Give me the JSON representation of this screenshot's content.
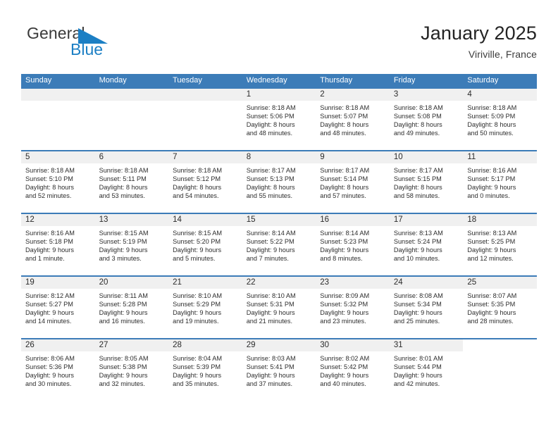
{
  "logo": {
    "word1": "General",
    "word2": "Blue",
    "triangle_color": "#1c7fc4",
    "word1_color": "#3a3a3a",
    "word2_color": "#1c7fc4"
  },
  "header": {
    "title": "January 2025",
    "subtitle": "Viriville, France"
  },
  "theme": {
    "header_bg": "#3c7cb8",
    "header_text": "#ffffff",
    "daynum_bg": "#f0f0f0",
    "row_border": "#3c7cb8",
    "body_text": "#2d2d2d"
  },
  "columns": [
    "Sunday",
    "Monday",
    "Tuesday",
    "Wednesday",
    "Thursday",
    "Friday",
    "Saturday"
  ],
  "weeks": [
    [
      {
        "day": "",
        "empty": true
      },
      {
        "day": "",
        "empty": true
      },
      {
        "day": "",
        "empty": true
      },
      {
        "day": "1",
        "sunrise": "Sunrise: 8:18 AM",
        "sunset": "Sunset: 5:06 PM",
        "daylight1": "Daylight: 8 hours",
        "daylight2": "and 48 minutes."
      },
      {
        "day": "2",
        "sunrise": "Sunrise: 8:18 AM",
        "sunset": "Sunset: 5:07 PM",
        "daylight1": "Daylight: 8 hours",
        "daylight2": "and 48 minutes."
      },
      {
        "day": "3",
        "sunrise": "Sunrise: 8:18 AM",
        "sunset": "Sunset: 5:08 PM",
        "daylight1": "Daylight: 8 hours",
        "daylight2": "and 49 minutes."
      },
      {
        "day": "4",
        "sunrise": "Sunrise: 8:18 AM",
        "sunset": "Sunset: 5:09 PM",
        "daylight1": "Daylight: 8 hours",
        "daylight2": "and 50 minutes."
      }
    ],
    [
      {
        "day": "5",
        "sunrise": "Sunrise: 8:18 AM",
        "sunset": "Sunset: 5:10 PM",
        "daylight1": "Daylight: 8 hours",
        "daylight2": "and 52 minutes."
      },
      {
        "day": "6",
        "sunrise": "Sunrise: 8:18 AM",
        "sunset": "Sunset: 5:11 PM",
        "daylight1": "Daylight: 8 hours",
        "daylight2": "and 53 minutes."
      },
      {
        "day": "7",
        "sunrise": "Sunrise: 8:18 AM",
        "sunset": "Sunset: 5:12 PM",
        "daylight1": "Daylight: 8 hours",
        "daylight2": "and 54 minutes."
      },
      {
        "day": "8",
        "sunrise": "Sunrise: 8:17 AM",
        "sunset": "Sunset: 5:13 PM",
        "daylight1": "Daylight: 8 hours",
        "daylight2": "and 55 minutes."
      },
      {
        "day": "9",
        "sunrise": "Sunrise: 8:17 AM",
        "sunset": "Sunset: 5:14 PM",
        "daylight1": "Daylight: 8 hours",
        "daylight2": "and 57 minutes."
      },
      {
        "day": "10",
        "sunrise": "Sunrise: 8:17 AM",
        "sunset": "Sunset: 5:15 PM",
        "daylight1": "Daylight: 8 hours",
        "daylight2": "and 58 minutes."
      },
      {
        "day": "11",
        "sunrise": "Sunrise: 8:16 AM",
        "sunset": "Sunset: 5:17 PM",
        "daylight1": "Daylight: 9 hours",
        "daylight2": "and 0 minutes."
      }
    ],
    [
      {
        "day": "12",
        "sunrise": "Sunrise: 8:16 AM",
        "sunset": "Sunset: 5:18 PM",
        "daylight1": "Daylight: 9 hours",
        "daylight2": "and 1 minute."
      },
      {
        "day": "13",
        "sunrise": "Sunrise: 8:15 AM",
        "sunset": "Sunset: 5:19 PM",
        "daylight1": "Daylight: 9 hours",
        "daylight2": "and 3 minutes."
      },
      {
        "day": "14",
        "sunrise": "Sunrise: 8:15 AM",
        "sunset": "Sunset: 5:20 PM",
        "daylight1": "Daylight: 9 hours",
        "daylight2": "and 5 minutes."
      },
      {
        "day": "15",
        "sunrise": "Sunrise: 8:14 AM",
        "sunset": "Sunset: 5:22 PM",
        "daylight1": "Daylight: 9 hours",
        "daylight2": "and 7 minutes."
      },
      {
        "day": "16",
        "sunrise": "Sunrise: 8:14 AM",
        "sunset": "Sunset: 5:23 PM",
        "daylight1": "Daylight: 9 hours",
        "daylight2": "and 8 minutes."
      },
      {
        "day": "17",
        "sunrise": "Sunrise: 8:13 AM",
        "sunset": "Sunset: 5:24 PM",
        "daylight1": "Daylight: 9 hours",
        "daylight2": "and 10 minutes."
      },
      {
        "day": "18",
        "sunrise": "Sunrise: 8:13 AM",
        "sunset": "Sunset: 5:25 PM",
        "daylight1": "Daylight: 9 hours",
        "daylight2": "and 12 minutes."
      }
    ],
    [
      {
        "day": "19",
        "sunrise": "Sunrise: 8:12 AM",
        "sunset": "Sunset: 5:27 PM",
        "daylight1": "Daylight: 9 hours",
        "daylight2": "and 14 minutes."
      },
      {
        "day": "20",
        "sunrise": "Sunrise: 8:11 AM",
        "sunset": "Sunset: 5:28 PM",
        "daylight1": "Daylight: 9 hours",
        "daylight2": "and 16 minutes."
      },
      {
        "day": "21",
        "sunrise": "Sunrise: 8:10 AM",
        "sunset": "Sunset: 5:29 PM",
        "daylight1": "Daylight: 9 hours",
        "daylight2": "and 19 minutes."
      },
      {
        "day": "22",
        "sunrise": "Sunrise: 8:10 AM",
        "sunset": "Sunset: 5:31 PM",
        "daylight1": "Daylight: 9 hours",
        "daylight2": "and 21 minutes."
      },
      {
        "day": "23",
        "sunrise": "Sunrise: 8:09 AM",
        "sunset": "Sunset: 5:32 PM",
        "daylight1": "Daylight: 9 hours",
        "daylight2": "and 23 minutes."
      },
      {
        "day": "24",
        "sunrise": "Sunrise: 8:08 AM",
        "sunset": "Sunset: 5:34 PM",
        "daylight1": "Daylight: 9 hours",
        "daylight2": "and 25 minutes."
      },
      {
        "day": "25",
        "sunrise": "Sunrise: 8:07 AM",
        "sunset": "Sunset: 5:35 PM",
        "daylight1": "Daylight: 9 hours",
        "daylight2": "and 28 minutes."
      }
    ],
    [
      {
        "day": "26",
        "sunrise": "Sunrise: 8:06 AM",
        "sunset": "Sunset: 5:36 PM",
        "daylight1": "Daylight: 9 hours",
        "daylight2": "and 30 minutes."
      },
      {
        "day": "27",
        "sunrise": "Sunrise: 8:05 AM",
        "sunset": "Sunset: 5:38 PM",
        "daylight1": "Daylight: 9 hours",
        "daylight2": "and 32 minutes."
      },
      {
        "day": "28",
        "sunrise": "Sunrise: 8:04 AM",
        "sunset": "Sunset: 5:39 PM",
        "daylight1": "Daylight: 9 hours",
        "daylight2": "and 35 minutes."
      },
      {
        "day": "29",
        "sunrise": "Sunrise: 8:03 AM",
        "sunset": "Sunset: 5:41 PM",
        "daylight1": "Daylight: 9 hours",
        "daylight2": "and 37 minutes."
      },
      {
        "day": "30",
        "sunrise": "Sunrise: 8:02 AM",
        "sunset": "Sunset: 5:42 PM",
        "daylight1": "Daylight: 9 hours",
        "daylight2": "and 40 minutes."
      },
      {
        "day": "31",
        "sunrise": "Sunrise: 8:01 AM",
        "sunset": "Sunset: 5:44 PM",
        "daylight1": "Daylight: 9 hours",
        "daylight2": "and 42 minutes."
      },
      {
        "day": "",
        "empty": true,
        "noband": true
      }
    ]
  ]
}
